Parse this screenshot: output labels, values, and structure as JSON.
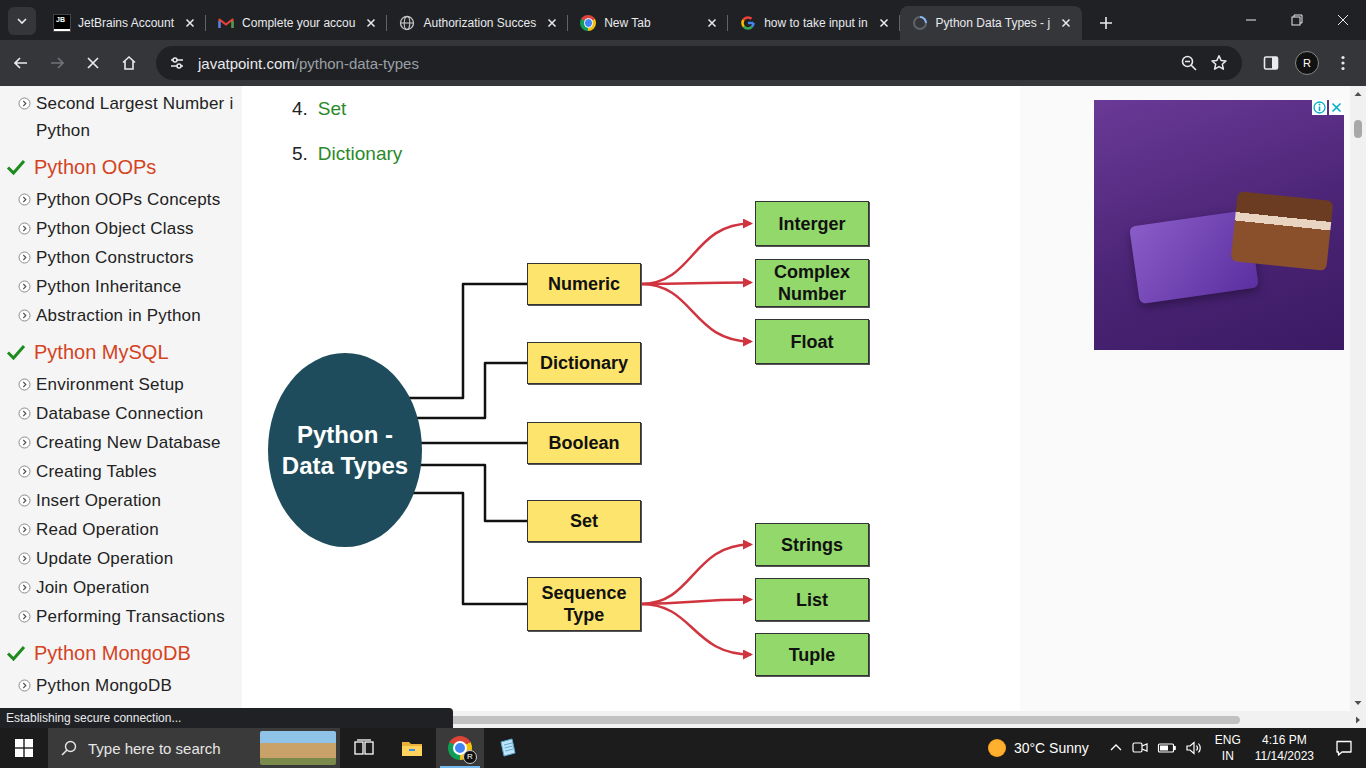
{
  "browser": {
    "tabs": [
      {
        "label": "JetBrains Account",
        "favicon": "jetbrains",
        "favicon_text": "JB",
        "selected": false
      },
      {
        "label": "Complete your accou",
        "favicon": "gmail",
        "selected": false
      },
      {
        "label": "Authorization Succes",
        "favicon": "globe",
        "selected": false
      },
      {
        "label": "New Tab",
        "favicon": "chrome",
        "selected": false
      },
      {
        "label": "how to take input in",
        "favicon": "google",
        "selected": false
      },
      {
        "label": "Python Data Types - j",
        "favicon": "loading",
        "selected": true
      }
    ],
    "forward_enabled": false,
    "loading": true,
    "url_host": "javatpoint.com",
    "url_path": "/python-data-types",
    "bookmarked": false,
    "profile_initial": "R"
  },
  "sidebar": {
    "entries": [
      {
        "kind": "item",
        "lines": [
          "Second Largest Number i",
          "Python"
        ]
      },
      {
        "kind": "header",
        "label": "Python OOPs",
        "checked": true
      },
      {
        "kind": "item",
        "lines": [
          "Python OOPs Concepts"
        ]
      },
      {
        "kind": "item",
        "lines": [
          "Python Object Class"
        ]
      },
      {
        "kind": "item",
        "lines": [
          "Python Constructors"
        ]
      },
      {
        "kind": "item",
        "lines": [
          "Python Inheritance"
        ]
      },
      {
        "kind": "item",
        "lines": [
          "Abstraction in Python"
        ]
      },
      {
        "kind": "header",
        "label": "Python MySQL",
        "checked": true
      },
      {
        "kind": "item",
        "lines": [
          "Environment Setup"
        ]
      },
      {
        "kind": "item",
        "lines": [
          "Database Connection"
        ]
      },
      {
        "kind": "item",
        "lines": [
          "Creating New Database"
        ]
      },
      {
        "kind": "item",
        "lines": [
          "Creating Tables"
        ]
      },
      {
        "kind": "item",
        "lines": [
          "Insert Operation"
        ]
      },
      {
        "kind": "item",
        "lines": [
          "Read Operation"
        ]
      },
      {
        "kind": "item",
        "lines": [
          "Update Operation"
        ]
      },
      {
        "kind": "item",
        "lines": [
          "Join Operation"
        ]
      },
      {
        "kind": "item",
        "lines": [
          "Performing Transactions"
        ]
      },
      {
        "kind": "header",
        "label": "Python MongoDB",
        "checked": true
      },
      {
        "kind": "item",
        "lines": [
          "Python MongoDB"
        ]
      }
    ]
  },
  "page": {
    "list": [
      {
        "num": "4.",
        "label": "Set"
      },
      {
        "num": "5.",
        "label": "Dictionary"
      }
    ],
    "diagram": {
      "root": "Python - Data Types",
      "branches": [
        {
          "label": "Numeric",
          "children": [
            "Interger",
            "Complex Number",
            "Float"
          ]
        },
        {
          "label": "Dictionary",
          "children": []
        },
        {
          "label": "Boolean",
          "children": []
        },
        {
          "label": "Set",
          "children": []
        },
        {
          "label": "Sequence Type",
          "children": [
            "Strings",
            "List",
            "Tuple"
          ]
        }
      ]
    }
  },
  "status_bubble": "Establishing secure connection...",
  "taskbar": {
    "search_placeholder": "Type here to search",
    "apps": [
      {
        "app": "task-view",
        "active": false
      },
      {
        "app": "file-explorer",
        "active": false
      },
      {
        "app": "chrome",
        "active": true,
        "badge": "R"
      },
      {
        "app": "notepad",
        "active": false
      }
    ],
    "weather": "30°C Sunny",
    "language": "ENG",
    "region": "IN",
    "time": "4:16 PM",
    "date": "11/14/2023"
  }
}
